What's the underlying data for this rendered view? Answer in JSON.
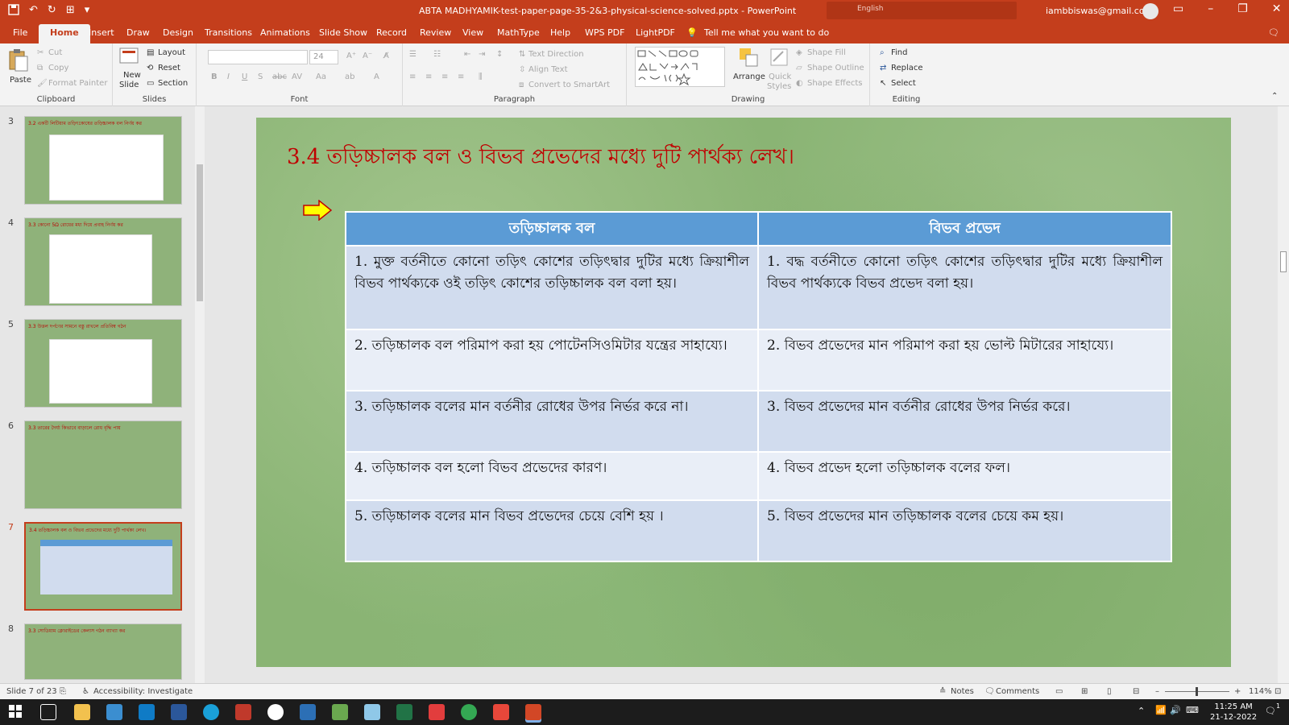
{
  "window": {
    "title": "ABTA MADHYAMIK-test-paper-page-35-2&3-physical-science-solved.pptx  -  PowerPoint",
    "language": "English",
    "account": "iambbiswas@gmail.com",
    "avatar_letter": "i"
  },
  "tabs": [
    "File",
    "Home",
    "Insert",
    "Draw",
    "Design",
    "Transitions",
    "Animations",
    "Slide Show",
    "Record",
    "Review",
    "View",
    "MathType",
    "Help",
    "WPS PDF",
    "LightPDF"
  ],
  "active_tab": "Home",
  "tell_me": "Tell me what you want to do",
  "ribbon": {
    "clipboard": {
      "label": "Clipboard",
      "paste": "Paste",
      "cut": "Cut",
      "copy": "Copy",
      "format_painter": "Format Painter"
    },
    "slides": {
      "label": "Slides",
      "new_slide_1": "New",
      "new_slide_2": "Slide",
      "layout": "Layout",
      "reset": "Reset",
      "section": "Section"
    },
    "font": {
      "label": "Font",
      "font_size": "24"
    },
    "paragraph": {
      "label": "Paragraph",
      "text_direction": "Text Direction",
      "align_text": "Align Text",
      "convert_smartart": "Convert to SmartArt"
    },
    "drawing": {
      "label": "Drawing",
      "arrange": "Arrange",
      "quick_styles_1": "Quick",
      "quick_styles_2": "Styles",
      "shape_fill": "Shape Fill",
      "shape_outline": "Shape Outline",
      "shape_effects": "Shape Effects"
    },
    "editing": {
      "label": "Editing",
      "find": "Find",
      "replace": "Replace",
      "select": "Select"
    }
  },
  "thumbnails": [
    {
      "num": "3",
      "title": "3.2 একটি লিটিয়াম তড়িৎকোষের তড়িচ্চালক বল নির্ণয় কর"
    },
    {
      "num": "4",
      "title": "3.3 কোনো 5Ω রোধের মধ্য দিয়ে প্রবাহ নির্ণয় কর"
    },
    {
      "num": "5",
      "title": "3.3 উত্তল দর্পণের সামনে বস্তু রাখলে প্রতিবিম্ব গঠন"
    },
    {
      "num": "6",
      "title": "3.3 তারের দৈর্ঘ্য কিভাবে বাড়ালে রোধ বৃদ্ধি পায়"
    },
    {
      "num": "7",
      "title": "3.4 তড়িচ্চালক বল ও বিভব প্রভেদের মধ্যে দুটি পার্থক্য লেখ।"
    },
    {
      "num": "8",
      "title": "3.3 সোডিয়াম ক্লোরাইডের কেলাস গঠন ব্যাখ্যা কর"
    }
  ],
  "slide": {
    "title": "3.4 তড়িচ্চালক বল ও বিভব প্রভেদের মধ্যে দুটি পার্থক্য লেখ।",
    "headers": [
      "তড়িচ্চালক বল",
      "বিভব প্রভেদ"
    ],
    "rows": [
      [
        "1. মুক্ত বর্তনীতে কোনো তড়িৎ কোশের তড়িৎদ্বার দুটির মধ্যে ক্রিয়াশীল বিভব পার্থক্যকে ওই তড়িৎ কোশের তড়িচ্চালক বল বলা হয়।",
        "1. বদ্ধ বর্তনীতে কোনো তড়িৎ কোশের তড়িৎদ্বার দুটির মধ্যে ক্রিয়াশীল বিভব পার্থক্যকে বিভব প্রভেদ বলা হয়।"
      ],
      [
        "2. তড়িচ্চালক বল পরিমাপ করা হয় পোটেনসিওমিটার যন্ত্রের সাহায্যে।",
        "2. বিভব প্রভেদের মান পরিমাপ করা হয় ভোল্ট মিটারের সাহায্যে।"
      ],
      [
        "3. তড়িচ্চালক বলের মান বর্তনীর রোধের উপর নির্ভর করে না।",
        "3. বিভব প্রভেদের মান বর্তনীর রোধের উপর নির্ভর করে।"
      ],
      [
        "4. তড়িচ্চালক বল হলো বিভব প্রভেদের কারণ।",
        "4. বিভব প্রভেদ হলো তড়িচ্চালক বলের ফল।"
      ],
      [
        "5. তড়িচ্চালক বলের মান বিভব প্রভেদের চেয়ে বেশি হয় ।",
        "5. বিভব প্রভেদের মান তড়িচ্চালক বলের চেয়ে কম হয়।"
      ]
    ]
  },
  "status": {
    "slide_of": "Slide 7 of 23",
    "accessibility": "Accessibility: Investigate",
    "notes": "Notes",
    "comments": "Comments",
    "zoom": "114%"
  },
  "taskbar": {
    "time": "11:25 AM",
    "date": "21-12-2022",
    "notification_count": "1"
  },
  "colors": {
    "accent": "#c43e1c",
    "table_header": "#5b9bd5",
    "title_red": "#c00000"
  }
}
